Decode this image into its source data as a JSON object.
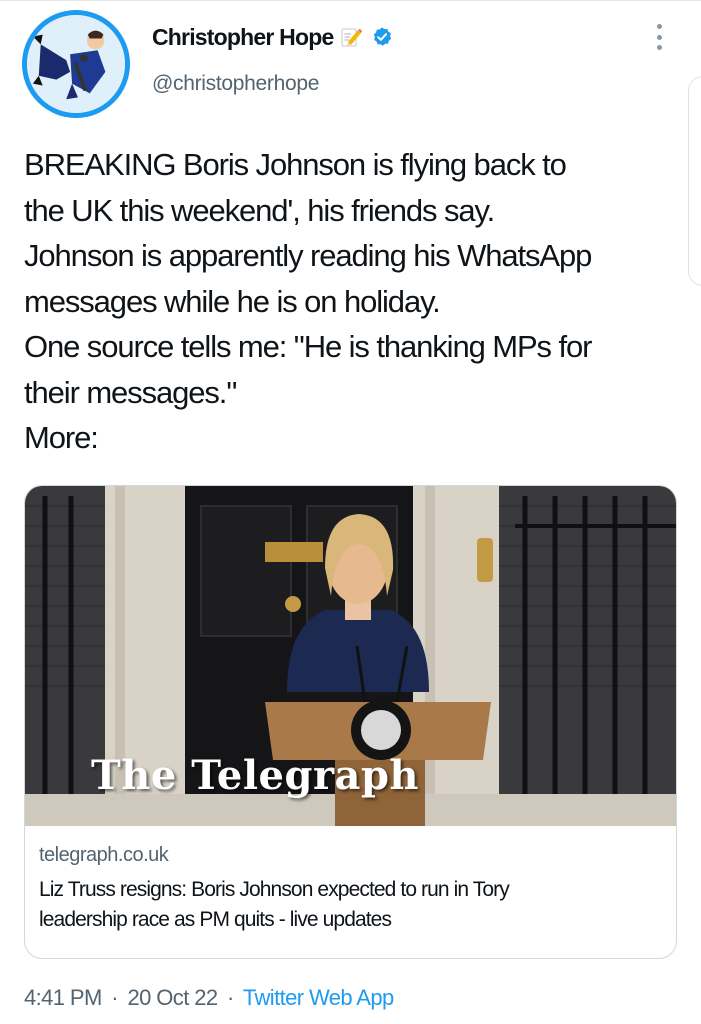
{
  "author": {
    "display_name": "Christopher Hope",
    "handle": "@christopherhope",
    "name_emoji": "memo-pencil-icon",
    "verified_icon": "verified-badge-icon"
  },
  "tweet": {
    "lines": [
      "BREAKING Boris Johnson is flying back to",
      "the UK this weekend', his friends say.",
      "Johnson is apparently reading his WhatsApp",
      "messages while he is on holiday.",
      "One source tells me: \"He is thanking MPs for",
      "their messages.\"",
      "More:"
    ]
  },
  "card": {
    "image_watermark": "The Telegraph",
    "domain": "telegraph.co.uk",
    "title_lines": [
      "Liz Truss resigns: Boris Johnson expected to run in Tory",
      "leadership race as PM quits - live updates"
    ]
  },
  "meta": {
    "time": "4:41 PM",
    "date": "20 Oct 22",
    "separator": "·",
    "source": "Twitter Web App"
  },
  "colors": {
    "accent": "#1d9bf0",
    "text": "#0f1419",
    "secondary": "#536471",
    "border": "#cfd9de"
  }
}
